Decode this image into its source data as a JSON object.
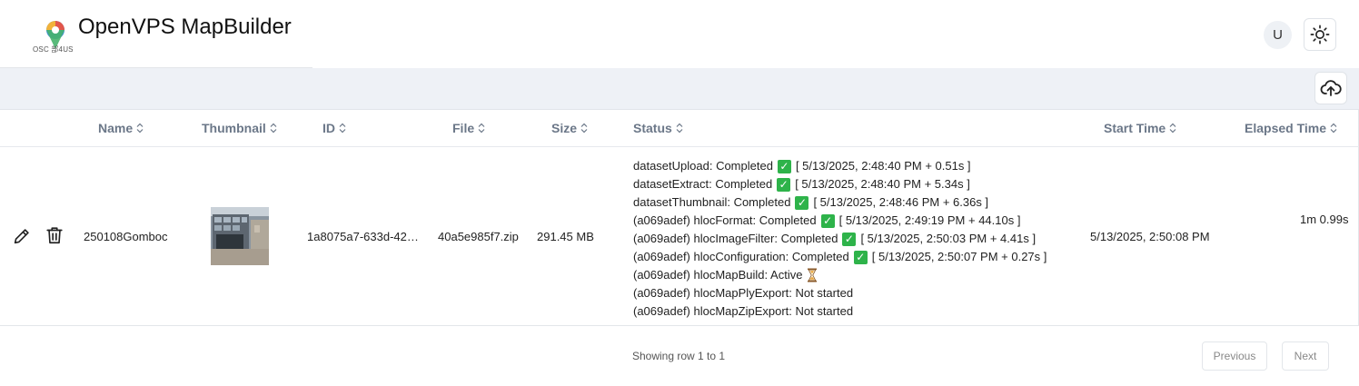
{
  "app": {
    "title": "OpenVPS MapBuilder",
    "logo_text": "OSC 部4US",
    "user_initial": "U"
  },
  "icons": {
    "theme": "sun-icon",
    "upload": "cloud-upload-icon",
    "edit": "pencil-icon",
    "delete": "trash-icon",
    "sort": "sort-icon",
    "completed": "check-mark-icon",
    "active": "hourglass-icon"
  },
  "colors": {
    "header_text": "#6b7788",
    "toolbar_bg": "#eef1f6",
    "check_green": "#2eb34a"
  },
  "table": {
    "columns": [
      "Name",
      "Thumbnail",
      "ID",
      "File",
      "Size",
      "Status",
      "Start Time",
      "Elapsed Time"
    ],
    "rows": [
      {
        "name": "250108Gomboc",
        "thumbnail": "building-photo",
        "id": "1a8075a7-633d-42…",
        "file": "40a5e985f7.zip",
        "size": "291.45 MB",
        "status": [
          {
            "pre": "datasetUpload: Completed",
            "check": true,
            "post": "[ 5/13/2025, 2:48:40 PM + 0.51s ]"
          },
          {
            "pre": "datasetExtract: Completed",
            "check": true,
            "post": "[ 5/13/2025, 2:48:40 PM + 5.34s ]"
          },
          {
            "pre": "datasetThumbnail: Completed",
            "check": true,
            "post": "[ 5/13/2025, 2:48:46 PM + 6.36s ]"
          },
          {
            "pre": "(a069adef) hlocFormat: Completed",
            "check": true,
            "post": "[ 5/13/2025, 2:49:19 PM + 44.10s ]"
          },
          {
            "pre": "(a069adef) hlocImageFilter: Completed",
            "check": true,
            "post": "[ 5/13/2025, 2:50:03 PM + 4.41s ]"
          },
          {
            "pre": "(a069adef) hlocConfiguration: Completed",
            "check": true,
            "post": "[ 5/13/2025, 2:50:07 PM + 0.27s ]"
          },
          {
            "pre": "(a069adef) hlocMapBuild: Active",
            "active": true,
            "post": ""
          },
          {
            "pre": "(a069adef) hlocMapPlyExport: Not started",
            "post": ""
          },
          {
            "pre": "(a069adef) hlocMapZipExport: Not started",
            "post": ""
          }
        ],
        "start_time": "5/13/2025, 2:50:08 PM",
        "elapsed_time": "1m 0.99s"
      }
    ]
  },
  "footer": {
    "showing": "Showing row 1 to 1",
    "previous": "Previous",
    "next": "Next"
  }
}
